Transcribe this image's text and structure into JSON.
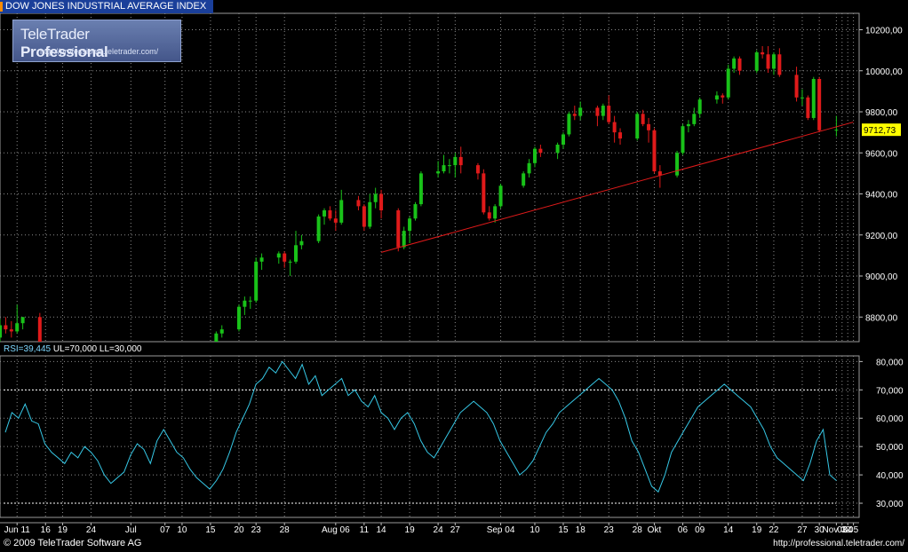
{
  "header": {
    "title": "DOW JONES INDUSTRIAL AVERAGE INDEX"
  },
  "logo": {
    "name_regular": "TeleTrader",
    "name_bold": "Professional",
    "url": "http://professional.teletrader.com/"
  },
  "footer": {
    "copyright": "© 2009 TeleTrader Software AG",
    "url": "http://professional.teletrader.com/"
  },
  "colors": {
    "up": "#19c219",
    "down": "#e01a1a",
    "trendline": "#e01a1a",
    "rsi": "#36c8e6",
    "grid": "#8c8c8c",
    "title_bg": "#1a3f9a",
    "last_price_bg": "#ffff00"
  },
  "chart_data": [
    {
      "type": "candlestick",
      "title": "DOW JONES INDUSTRIAL AVERAGE INDEX",
      "ylim": [
        8680,
        10280
      ],
      "yticks": [
        8800,
        9000,
        9200,
        9400,
        9600,
        9800,
        10000,
        10200
      ],
      "ytick_labels": [
        "8800,00",
        "9000,00",
        "9200,00",
        "9400,00",
        "9600,00",
        "9800,00",
        "10000,00",
        "10200,00"
      ],
      "last_price": {
        "value": 9712.73,
        "label": "9712,73"
      },
      "trendline": [
        [
          "2009-08-14",
          9115
        ],
        [
          "2009-11-05",
          9750
        ]
      ],
      "grid": true,
      "ohlc": [
        [
          "2009-06-08",
          8700,
          8790,
          8680,
          8760
        ],
        [
          "2009-06-09",
          8760,
          8800,
          8720,
          8740
        ],
        [
          "2009-06-10",
          8740,
          8780,
          8700,
          8730
        ],
        [
          "2009-06-11",
          8730,
          8860,
          8720,
          8770
        ],
        [
          "2009-06-12",
          8770,
          8800,
          8740,
          8800
        ],
        [
          "2009-06-15",
          8800,
          8820,
          8580,
          8610
        ],
        [
          "2009-06-16",
          8610,
          8650,
          8490,
          8500
        ],
        [
          "2009-06-17",
          8500,
          8540,
          8470,
          8500
        ],
        [
          "2009-06-18",
          8500,
          8580,
          8480,
          8560
        ],
        [
          "2009-06-19",
          8560,
          8620,
          8520,
          8540
        ],
        [
          "2009-06-22",
          8540,
          8560,
          8320,
          8340
        ],
        [
          "2009-06-23",
          8340,
          8370,
          8300,
          8320
        ],
        [
          "2009-06-24",
          8320,
          8400,
          8300,
          8300
        ],
        [
          "2009-06-25",
          8300,
          8480,
          8290,
          8470
        ],
        [
          "2009-06-26",
          8470,
          8500,
          8420,
          8440
        ],
        [
          "2009-06-29",
          8440,
          8550,
          8430,
          8530
        ],
        [
          "2009-06-30",
          8530,
          8560,
          8430,
          8450
        ],
        [
          "2009-07-01",
          8450,
          8530,
          8440,
          8500
        ],
        [
          "2009-07-02",
          8500,
          8510,
          8270,
          8280
        ],
        [
          "2009-07-06",
          8280,
          8330,
          8220,
          8320
        ],
        [
          "2009-07-07",
          8320,
          8330,
          8150,
          8160
        ],
        [
          "2009-07-08",
          8160,
          8220,
          8120,
          8180
        ],
        [
          "2009-07-09",
          8180,
          8250,
          8150,
          8190
        ],
        [
          "2009-07-10",
          8190,
          8200,
          8120,
          8150
        ],
        [
          "2009-07-13",
          8150,
          8350,
          8140,
          8330
        ],
        [
          "2009-07-14",
          8330,
          8380,
          8300,
          8360
        ],
        [
          "2009-07-15",
          8360,
          8640,
          8350,
          8620
        ],
        [
          "2009-07-16",
          8620,
          8730,
          8600,
          8720
        ],
        [
          "2009-07-17",
          8720,
          8760,
          8700,
          8740
        ],
        [
          "2009-07-20",
          8740,
          8860,
          8730,
          8850
        ],
        [
          "2009-07-21",
          8850,
          8900,
          8810,
          8880
        ],
        [
          "2009-07-22",
          8880,
          8900,
          8840,
          8880
        ],
        [
          "2009-07-23",
          8880,
          9090,
          8870,
          9070
        ],
        [
          "2009-07-24",
          9070,
          9110,
          9030,
          9090
        ],
        [
          "2009-07-27",
          9090,
          9120,
          9060,
          9110
        ],
        [
          "2009-07-28",
          9110,
          9120,
          9040,
          9070
        ],
        [
          "2009-07-29",
          9070,
          9080,
          9000,
          9070
        ],
        [
          "2009-07-30",
          9070,
          9220,
          9060,
          9150
        ],
        [
          "2009-07-31",
          9150,
          9200,
          9130,
          9170
        ],
        [
          "2009-08-03",
          9170,
          9300,
          9160,
          9290
        ],
        [
          "2009-08-04",
          9290,
          9330,
          9250,
          9320
        ],
        [
          "2009-08-05",
          9320,
          9340,
          9270,
          9280
        ],
        [
          "2009-08-06",
          9280,
          9320,
          9220,
          9260
        ],
        [
          "2009-08-07",
          9260,
          9420,
          9250,
          9370
        ],
        [
          "2009-08-10",
          9370,
          9390,
          9320,
          9340
        ],
        [
          "2009-08-11",
          9340,
          9350,
          9220,
          9240
        ],
        [
          "2009-08-12",
          9240,
          9400,
          9230,
          9360
        ],
        [
          "2009-08-13",
          9360,
          9430,
          9330,
          9400
        ],
        [
          "2009-08-14",
          9400,
          9420,
          9280,
          9320
        ],
        [
          "2009-08-17",
          9320,
          9330,
          9120,
          9140
        ],
        [
          "2009-08-18",
          9140,
          9240,
          9130,
          9220
        ],
        [
          "2009-08-19",
          9220,
          9290,
          9160,
          9280
        ],
        [
          "2009-08-20",
          9280,
          9360,
          9270,
          9350
        ],
        [
          "2009-08-21",
          9350,
          9510,
          9340,
          9500
        ],
        [
          "2009-08-24",
          9500,
          9560,
          9480,
          9510
        ],
        [
          "2009-08-25",
          9510,
          9590,
          9500,
          9540
        ],
        [
          "2009-08-26",
          9540,
          9570,
          9500,
          9540
        ],
        [
          "2009-08-27",
          9540,
          9600,
          9480,
          9580
        ],
        [
          "2009-08-28",
          9580,
          9630,
          9500,
          9540
        ],
        [
          "2009-08-31",
          9540,
          9550,
          9470,
          9500
        ],
        [
          "2009-09-01",
          9500,
          9520,
          9300,
          9310
        ],
        [
          "2009-09-02",
          9310,
          9340,
          9270,
          9280
        ],
        [
          "2009-09-03",
          9280,
          9350,
          9260,
          9340
        ],
        [
          "2009-09-04",
          9340,
          9450,
          9330,
          9440
        ],
        [
          "2009-09-08",
          9440,
          9510,
          9430,
          9500
        ],
        [
          "2009-09-09",
          9500,
          9570,
          9480,
          9550
        ],
        [
          "2009-09-10",
          9550,
          9630,
          9530,
          9620
        ],
        [
          "2009-09-11",
          9620,
          9640,
          9580,
          9600
        ],
        [
          "2009-09-14",
          9600,
          9650,
          9570,
          9640
        ],
        [
          "2009-09-15",
          9640,
          9700,
          9620,
          9690
        ],
        [
          "2009-09-16",
          9690,
          9800,
          9680,
          9790
        ],
        [
          "2009-09-17",
          9790,
          9830,
          9760,
          9780
        ],
        [
          "2009-09-18",
          9780,
          9850,
          9760,
          9820
        ],
        [
          "2009-09-21",
          9820,
          9830,
          9730,
          9780
        ],
        [
          "2009-09-22",
          9780,
          9840,
          9760,
          9830
        ],
        [
          "2009-09-23",
          9830,
          9880,
          9740,
          9750
        ],
        [
          "2009-09-24",
          9750,
          9780,
          9650,
          9700
        ],
        [
          "2009-09-25",
          9700,
          9720,
          9640,
          9670
        ],
        [
          "2009-09-28",
          9670,
          9800,
          9660,
          9790
        ],
        [
          "2009-09-29",
          9790,
          9810,
          9730,
          9740
        ],
        [
          "2009-09-30",
          9740,
          9770,
          9650,
          9710
        ],
        [
          "2009-10-01",
          9710,
          9720,
          9500,
          9510
        ],
        [
          "2009-10-02",
          9510,
          9540,
          9430,
          9490
        ],
        [
          "2009-10-05",
          9490,
          9610,
          9480,
          9600
        ],
        [
          "2009-10-06",
          9600,
          9740,
          9590,
          9730
        ],
        [
          "2009-10-07",
          9730,
          9760,
          9700,
          9740
        ],
        [
          "2009-10-08",
          9740,
          9820,
          9730,
          9790
        ],
        [
          "2009-10-09",
          9790,
          9870,
          9770,
          9860
        ],
        [
          "2009-10-12",
          9860,
          9900,
          9840,
          9880
        ],
        [
          "2009-10-13",
          9880,
          9890,
          9840,
          9870
        ],
        [
          "2009-10-14",
          9870,
          10030,
          9860,
          10010
        ],
        [
          "2009-10-15",
          10010,
          10070,
          9990,
          10060
        ],
        [
          "2009-10-16",
          10060,
          10070,
          9980,
          10000
        ],
        [
          "2009-10-19",
          10000,
          10100,
          9990,
          10090
        ],
        [
          "2009-10-20",
          10090,
          10120,
          10060,
          10080
        ],
        [
          "2009-10-21",
          10080,
          10120,
          9990,
          10010
        ],
        [
          "2009-10-22",
          10010,
          10090,
          9980,
          10080
        ],
        [
          "2009-10-23",
          10080,
          10110,
          9970,
          9980
        ],
        [
          "2009-10-26",
          9980,
          10020,
          9850,
          9870
        ],
        [
          "2009-10-27",
          9870,
          9910,
          9830,
          9870
        ],
        [
          "2009-10-28",
          9870,
          9880,
          9760,
          9770
        ],
        [
          "2009-10-29",
          9770,
          9970,
          9760,
          9960
        ],
        [
          "2009-10-30",
          9960,
          9970,
          9700,
          9710
        ],
        [
          "2009-11-02",
          9710,
          9780,
          9680,
          9712.73
        ]
      ]
    },
    {
      "type": "line",
      "series": [
        {
          "name": "RSI",
          "label_value": "39,445"
        }
      ],
      "ylim": [
        25,
        82
      ],
      "yticks": [
        30,
        40,
        50,
        60,
        70,
        80
      ],
      "ytick_labels": [
        "30,000",
        "40,000",
        "50,000",
        "60,000",
        "70,000",
        "80,000"
      ],
      "level_lines": [
        70,
        30
      ],
      "label": {
        "name": "RSI",
        "value": "39,445",
        "ul": "UL=70,000",
        "ll": "LL=30,000"
      },
      "rsi_values": [
        55,
        62,
        60,
        65,
        59,
        58,
        51,
        48,
        46,
        44,
        48,
        46,
        50,
        48,
        45,
        40,
        37,
        39,
        41,
        47,
        51,
        49,
        44,
        52,
        56,
        52,
        48,
        46,
        42,
        39,
        37,
        35,
        38,
        42,
        48,
        55,
        60,
        65,
        72,
        74,
        78,
        76,
        80,
        77,
        74,
        79,
        72,
        75,
        68,
        70,
        72,
        74,
        68,
        70,
        66,
        64,
        68,
        62,
        60,
        56,
        60,
        62,
        58,
        52,
        48,
        46,
        50,
        54,
        58,
        62,
        64,
        66,
        64,
        62,
        58,
        52,
        48,
        44,
        40,
        42,
        45,
        50,
        55,
        58,
        62,
        64,
        66,
        68,
        70,
        72,
        74,
        72,
        70,
        66,
        60,
        52,
        48,
        42,
        36,
        34,
        40,
        48,
        52,
        56,
        60,
        64,
        66,
        68,
        70,
        72,
        70,
        68,
        66,
        64,
        60,
        56,
        50,
        46,
        44,
        42,
        40,
        38,
        44,
        52,
        56,
        40,
        38
      ]
    }
  ],
  "xaxis": {
    "start": "2009-06-08",
    "end": "2009-11-06",
    "ticks": [
      [
        "2009-06-11",
        "Jun 11"
      ],
      [
        "2009-06-16",
        "16"
      ],
      [
        "2009-06-19",
        "19"
      ],
      [
        "2009-06-24",
        "24"
      ],
      [
        "2009-07-01",
        "Jul"
      ],
      [
        "2009-07-07",
        "07"
      ],
      [
        "2009-07-10",
        "10"
      ],
      [
        "2009-07-15",
        "15"
      ],
      [
        "2009-07-20",
        "20"
      ],
      [
        "2009-07-23",
        "23"
      ],
      [
        "2009-07-28",
        "28"
      ],
      [
        "2009-08-06",
        "Aug 06"
      ],
      [
        "2009-08-11",
        "11"
      ],
      [
        "2009-08-14",
        "14"
      ],
      [
        "2009-08-19",
        "19"
      ],
      [
        "2009-08-24",
        "24"
      ],
      [
        "2009-08-27",
        "27"
      ],
      [
        "2009-09-04",
        "Sep 04"
      ],
      [
        "2009-09-10",
        "10"
      ],
      [
        "2009-09-15",
        "15"
      ],
      [
        "2009-09-18",
        "18"
      ],
      [
        "2009-09-23",
        "23"
      ],
      [
        "2009-09-28",
        "28"
      ],
      [
        "2009-10-01",
        "Okt"
      ],
      [
        "2009-10-06",
        "06"
      ],
      [
        "2009-10-09",
        "09"
      ],
      [
        "2009-10-14",
        "14"
      ],
      [
        "2009-10-19",
        "19"
      ],
      [
        "2009-10-22",
        "22"
      ],
      [
        "2009-10-27",
        "27"
      ],
      [
        "2009-10-30",
        "30"
      ],
      [
        "2009-11-02",
        "Nov 02"
      ],
      [
        "2009-11-03",
        "03"
      ],
      [
        "2009-11-04",
        "04"
      ],
      [
        "2009-11-05",
        "05"
      ]
    ]
  }
}
